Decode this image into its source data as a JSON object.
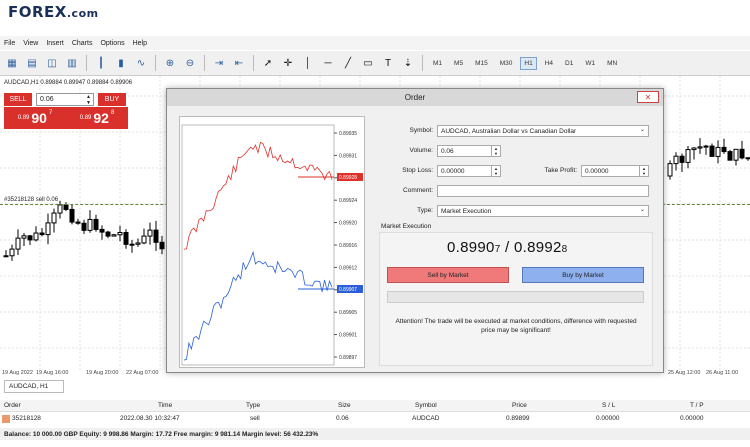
{
  "brand": {
    "logo": "FOREX",
    "domain": ".com"
  },
  "menu": [
    "File",
    "View",
    "Insert",
    "Charts",
    "Options",
    "Help"
  ],
  "toolbar": {
    "timeframes": [
      "M1",
      "M5",
      "M15",
      "M30",
      "H1",
      "H4",
      "D1",
      "W1",
      "MN"
    ],
    "active_timeframe": "H1"
  },
  "chart": {
    "title": "AUDCAD,H1  0.89884 0.89947 0.89884 0.89906",
    "one_click": {
      "sell_label": "SELL",
      "buy_label": "BUY",
      "lot": "0.06",
      "sell_price_small": "0.89",
      "sell_price_big": "90",
      "sell_price_sup": "7",
      "buy_price_small": "0.89",
      "buy_price_big": "92",
      "buy_price_sup": "8"
    },
    "order_line_label": "#35218128 sell 0.06",
    "dates": [
      "19 Aug 2022",
      "19 Aug 16:00",
      "19 Aug 20:00",
      "22 Aug 07:00",
      "25 Aug 12:00",
      "26 Aug 11:00"
    ],
    "tab_label": "AUDCAD, H1"
  },
  "dialog": {
    "title": "Order",
    "close": "✕",
    "symbol_label": "Symbol:",
    "symbol_value": "AUDCAD, Australian Dollar vs Canadian Dollar",
    "volume_label": "Volume:",
    "volume_value": "0.06",
    "stoploss_label": "Stop Loss:",
    "stoploss_value": "0.00000",
    "takeprofit_label": "Take Profit:",
    "takeprofit_value": "0.00000",
    "comment_label": "Comment:",
    "comment_value": "",
    "type_label": "Type:",
    "type_value": "Market Execution",
    "market_execution_label": "Market Execution",
    "bid_main": "0.8990",
    "bid_sub": "7",
    "sep": " / ",
    "ask_main": "0.8992",
    "ask_sub": "8",
    "sell_button": "Sell by Market",
    "buy_button": "Buy by Market",
    "attention_line1": "Attention! The trade will be executed at market conditions, difference with requested",
    "attention_line2": "price may be significant!",
    "axis_ticks": [
      "0.89935",
      "0.89931",
      "0.89928",
      "0.89924",
      "0.89920",
      "0.89916",
      "0.89912",
      "0.89909",
      "0.89905",
      "0.89901",
      "0.89897"
    ],
    "ask_tag": "0.89928",
    "bid_tag": "0.89907",
    "ask_color": "#e0302a",
    "bid_color": "#2a5fd8"
  },
  "terminal": {
    "headers": [
      "Order",
      "Time",
      "Type",
      "Size",
      "Symbol",
      "Price",
      "S / L",
      "T / P"
    ],
    "row": [
      "35218128",
      "2022.08.30 10:32:47",
      "sell",
      "0.06",
      "AUDCAD",
      "0.89899",
      "0.00000",
      "0.00000"
    ],
    "balance": "Balance: 10 000.00 GBP  Equity: 9 998.86  Margin: 17.72  Free margin: 9 981.14  Margin level: 56 432.23%"
  }
}
